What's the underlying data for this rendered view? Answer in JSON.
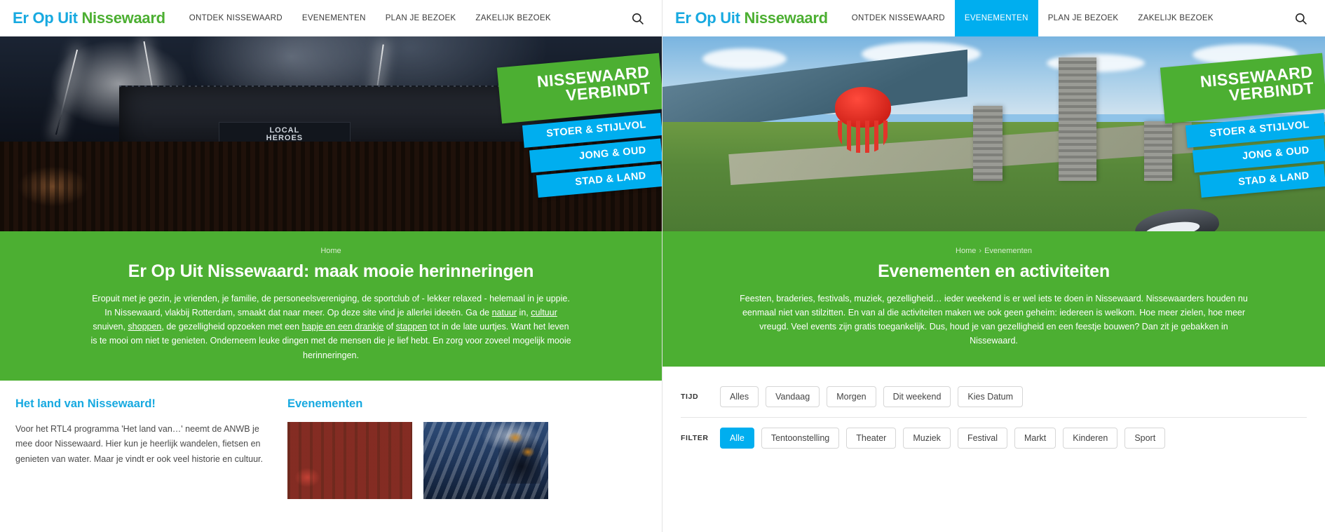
{
  "brand": {
    "part1": "Er Op Uit",
    "part2": "Nissewaard"
  },
  "colors": {
    "green": "#4caf32",
    "blue": "#00aeef",
    "logo_blue": "#17a9e0",
    "chip_border": "#d6d6d6"
  },
  "left": {
    "nav": [
      {
        "label": "ONTDEK NISSEWAARD",
        "active": false
      },
      {
        "label": "EVENEMENTEN",
        "active": false
      },
      {
        "label": "PLAN JE BEZOEK",
        "active": false
      },
      {
        "label": "ZAKELIJK BEZOEK",
        "active": false
      }
    ],
    "search_icon": "search-icon",
    "ribbons": {
      "big_line1": "NISSEWAARD",
      "big_line2": "VERBINDT",
      "small": [
        "STOER & STIJLVOL",
        "JONG & OUD",
        "STAD & LAND"
      ]
    },
    "hero_alt": "concert-crowd-photo",
    "breadcrumb": [
      "Home"
    ],
    "title": "Er Op Uit Nissewaard: maak mooie herinneringen",
    "intro_parts": {
      "p1": "Eropuit met je gezin, je vrienden, je familie, de personeelsvereniging, de sportclub of - lekker relaxed - helemaal in je uppie. In Nissewaard, vlakbij Rotterdam, smaakt dat naar meer. Op deze site vind je allerlei ideeën. Ga de ",
      "link1": "natuur",
      "p2": " in, ",
      "link2": "cultuur",
      "p3": " snuiven, ",
      "link3": "shoppen",
      "p4": ", de gezelligheid opzoeken met een ",
      "link4": "hapje en een drankje",
      "p5": " of ",
      "link5": "stappen",
      "p6": " tot in de late uurtjes. Want het leven is te mooi om niet te genieten. Onderneem leuke dingen met de mensen die je lief hebt. En zorg voor zoveel mogelijk mooie herinneringen."
    },
    "section_land": {
      "title": "Het land van Nissewaard!",
      "body": "Voor het RTL4 programma 'Het land van…' neemt de ANWB je mee door Nissewaard. Hier kun je heerlijk wandelen, fietsen en genieten van water. Maar je vindt er ook veel historie en cultuur."
    },
    "section_events": {
      "title": "Evenementen",
      "thumbs": [
        {
          "alt": "cyclists-in-forest-photo"
        },
        {
          "alt": "evening-sky-trees-photo"
        }
      ]
    }
  },
  "right": {
    "nav": [
      {
        "label": "ONTDEK NISSEWAARD",
        "active": false
      },
      {
        "label": "EVENEMENTEN",
        "active": true
      },
      {
        "label": "PLAN JE BEZOEK",
        "active": false
      },
      {
        "label": "ZAKELIJK BEZOEK",
        "active": false
      }
    ],
    "search_icon": "search-icon",
    "ribbons": {
      "big_line1": "NISSEWAARD",
      "big_line2": "VERBINDT",
      "small": [
        "STOER & STIJLVOL",
        "JONG & OUD",
        "STAD & LAND"
      ]
    },
    "hero_alt": "aerial-kite-festival-photo",
    "breadcrumb": [
      "Home",
      "Evenementen"
    ],
    "breadcrumb_sep": "›",
    "title": "Evenementen en activiteiten",
    "intro": "Feesten, braderies, festivals, muziek, gezelligheid… ieder weekend is er wel iets te doen in Nissewaard. Nissewaarders houden nu eenmaal niet van stilzitten. En van al die activiteiten maken we ook geen geheim: iedereen is welkom. Hoe meer zielen, hoe meer vreugd. Veel events zijn gratis toegankelijk. Dus, houd je van gezelligheid en een feestje bouwen? Dan zit je gebakken in Nissewaard.",
    "filters": {
      "time_label": "TIJD",
      "time_options": [
        {
          "label": "Alles",
          "active": false
        },
        {
          "label": "Vandaag",
          "active": false
        },
        {
          "label": "Morgen",
          "active": false
        },
        {
          "label": "Dit weekend",
          "active": false
        },
        {
          "label": "Kies Datum",
          "active": false
        }
      ],
      "filter_label": "FILTER",
      "filter_options": [
        {
          "label": "Alle",
          "active": true
        },
        {
          "label": "Tentoonstelling",
          "active": false
        },
        {
          "label": "Theater",
          "active": false
        },
        {
          "label": "Muziek",
          "active": false
        },
        {
          "label": "Festival",
          "active": false
        },
        {
          "label": "Markt",
          "active": false
        },
        {
          "label": "Kinderen",
          "active": false
        },
        {
          "label": "Sport",
          "active": false
        }
      ]
    }
  }
}
